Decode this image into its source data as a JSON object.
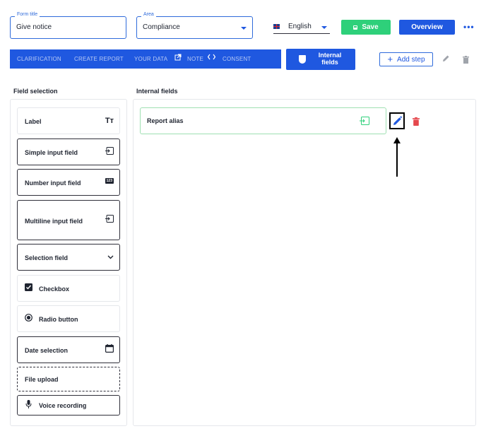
{
  "header": {
    "form_title": {
      "legend": "Form title",
      "value": "Give notice"
    },
    "area": {
      "legend": "Area",
      "value": "Compliance"
    },
    "language": {
      "label": "English",
      "icon": "uk-flag-icon"
    },
    "save_label": "Save",
    "overview_label": "Overview",
    "more_label": "•••"
  },
  "nav": {
    "items": [
      "CLARIFICATION",
      "CREATE REPORT",
      "YOUR DATA",
      "NOTE",
      "CONSENT"
    ],
    "active_step": {
      "line1": "Internal",
      "line2": "fields"
    },
    "add_step_label": "Add step",
    "accent": "#1f58e0"
  },
  "field_selection": {
    "heading": "Field selection",
    "items": [
      {
        "label": "Label",
        "icon": "text-size-icon"
      },
      {
        "label": "Simple input field",
        "icon": "input-icon"
      },
      {
        "label": "Number input field",
        "icon": "number-icon",
        "badge": "123"
      },
      {
        "label": "Multiline input field",
        "icon": "input-icon"
      },
      {
        "label": "Selection field",
        "icon": "chevron-down-icon"
      },
      {
        "label": "Checkbox",
        "icon": "checkbox-icon"
      },
      {
        "label": "Radio button",
        "icon": "radio-icon"
      },
      {
        "label": "Date selection",
        "icon": "calendar-icon"
      },
      {
        "label": "File upload"
      },
      {
        "label": "Voice recording",
        "icon": "microphone-icon"
      }
    ]
  },
  "internal_fields": {
    "heading": "Internal fields",
    "fields": [
      {
        "label": "Report alias",
        "icon": "input-icon"
      }
    ]
  },
  "colors": {
    "green": "#2ed07a",
    "blue": "#1f58e0",
    "red": "#e5484d"
  }
}
